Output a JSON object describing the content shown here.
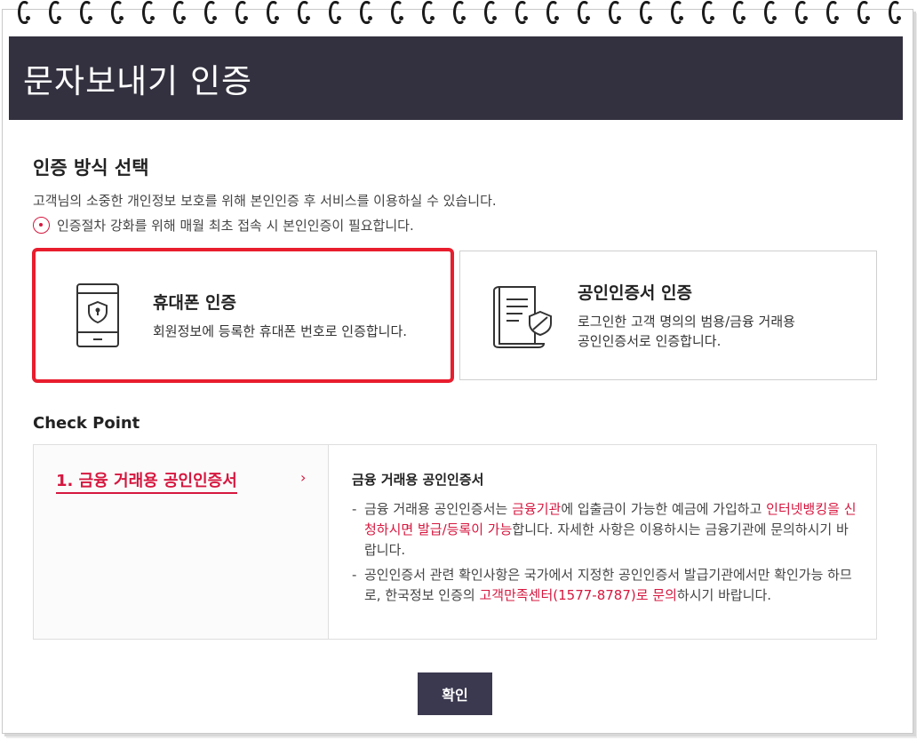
{
  "header": {
    "title": "문자보내기 인증"
  },
  "auth_section": {
    "title": "인증 방식 선택",
    "description": "고객님의 소중한 개인정보 보호를 위해 본인인증 후 서비스를 이용하실 수 있습니다.",
    "notice": "인증절차 강화를 위해 매월 최초 접속 시 본인인증이 필요합니다."
  },
  "auth_options": {
    "phone": {
      "title": "휴대폰 인증",
      "desc": "회원정보에 등록한 휴대폰 번호로 인증합니다.",
      "icon": "phone-shield-icon",
      "selected": true
    },
    "cert": {
      "title": "공인인증서 인증",
      "desc_line1": "로그인한 고객 명의의 범용/금융 거래용",
      "desc_line2": "공인인증서로 인증합니다.",
      "icon": "certificate-shield-icon"
    }
  },
  "check_point": {
    "title": "Check Point",
    "item_label": "1. 금융 거래용 공인인증서",
    "arrow": "›",
    "detail_title": "금융 거래용 공인인증서",
    "bullet1": {
      "t1": "금융 거래용 공인인증서는 ",
      "h1": "금융기관",
      "t2": "에 입출금이 가능한 예금에 가입하고 ",
      "h2": "인터넷뱅킹을 신청하시면 발급/등록이 가능",
      "t3": "합니다. 자세한 사항은 이용하시는 금융기관에 문의하시기 바랍니다."
    },
    "bullet2": {
      "t1": "공인인증서 관련 확인사항은 국가에서 지정한 공인인증서 발급기관에서만 확인가능 하므로, 한국정보 인증의 ",
      "h1": "고객만족센터(1577-8787)로 문의",
      "t2": "하시기 바랍니다."
    },
    "dash": "-"
  },
  "confirm": {
    "label": "확인"
  },
  "colors": {
    "header_bg": "#33313f",
    "accent": "#d6173f",
    "selected_border": "#e81d2d",
    "button_bg": "#3b3950"
  }
}
